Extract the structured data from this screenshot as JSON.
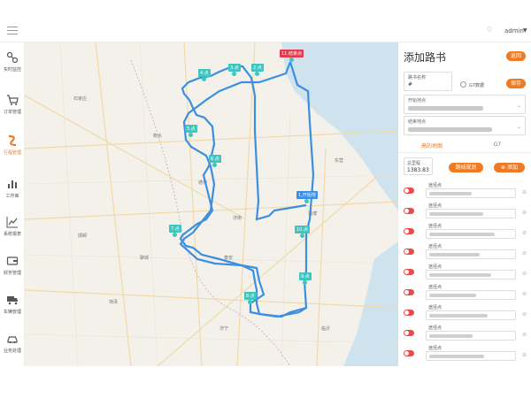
{
  "header": {
    "user_label": "admin",
    "bell_icon": "bell-icon",
    "menu_icon": "hamburger-icon"
  },
  "sidebar": {
    "items": [
      {
        "label": "实时监控",
        "icon": "monitor-icon",
        "active": false
      },
      {
        "label": "订单管理",
        "icon": "cart-icon",
        "active": false
      },
      {
        "label": "行程管理",
        "icon": "route-icon",
        "active": true
      },
      {
        "label": "工作串",
        "icon": "bars-chart-icon",
        "active": false
      },
      {
        "label": "系统报表",
        "icon": "line-chart-icon",
        "active": false
      },
      {
        "label": "财务管理",
        "icon": "wallet-icon",
        "active": false
      },
      {
        "label": "车辆管理",
        "icon": "truck-icon",
        "active": false
      },
      {
        "label": "业务处理",
        "icon": "car-icon",
        "active": false
      }
    ]
  },
  "map": {
    "places": [
      {
        "name": "石家庄"
      },
      {
        "name": "衡水"
      },
      {
        "name": "德州"
      },
      {
        "name": "济南"
      },
      {
        "name": "淄博"
      },
      {
        "name": "东营"
      },
      {
        "name": "邯郸"
      },
      {
        "name": "聊城"
      },
      {
        "name": "泰安"
      },
      {
        "name": "济宁"
      },
      {
        "name": "临沂"
      },
      {
        "name": "菏泽"
      }
    ],
    "waypoints": [
      {
        "label": "1.开始地",
        "kind": "start"
      },
      {
        "label": "2.点",
        "kind": "mid"
      },
      {
        "label": "3.点",
        "kind": "mid"
      },
      {
        "label": "4.点",
        "kind": "mid"
      },
      {
        "label": "5.点",
        "kind": "mid"
      },
      {
        "label": "6.点",
        "kind": "mid"
      },
      {
        "label": "7.点",
        "kind": "mid"
      },
      {
        "label": "8.点",
        "kind": "mid"
      },
      {
        "label": "9.点",
        "kind": "mid"
      },
      {
        "label": "10.点",
        "kind": "mid"
      },
      {
        "label": "11.结束点",
        "kind": "end"
      }
    ],
    "route_color": "#3c8fe0"
  },
  "panel": {
    "title": "添加路书",
    "back_button": "返回",
    "save_button": "保存",
    "route_name_label": "路书名称",
    "route_name_value": "#",
    "g7_label": "G7数据",
    "start_label": "开始地点",
    "end_label": "结束地点",
    "tabs": [
      "高的地图",
      "G7"
    ],
    "distance_label": "总里程",
    "distance_value": "1383.83",
    "plan_button": "路线规划",
    "add_button": "添加",
    "add_icon": "plus-icon",
    "waypoint_label": "途径点",
    "waypoint_rows": 9,
    "accent": "#f07a21"
  }
}
